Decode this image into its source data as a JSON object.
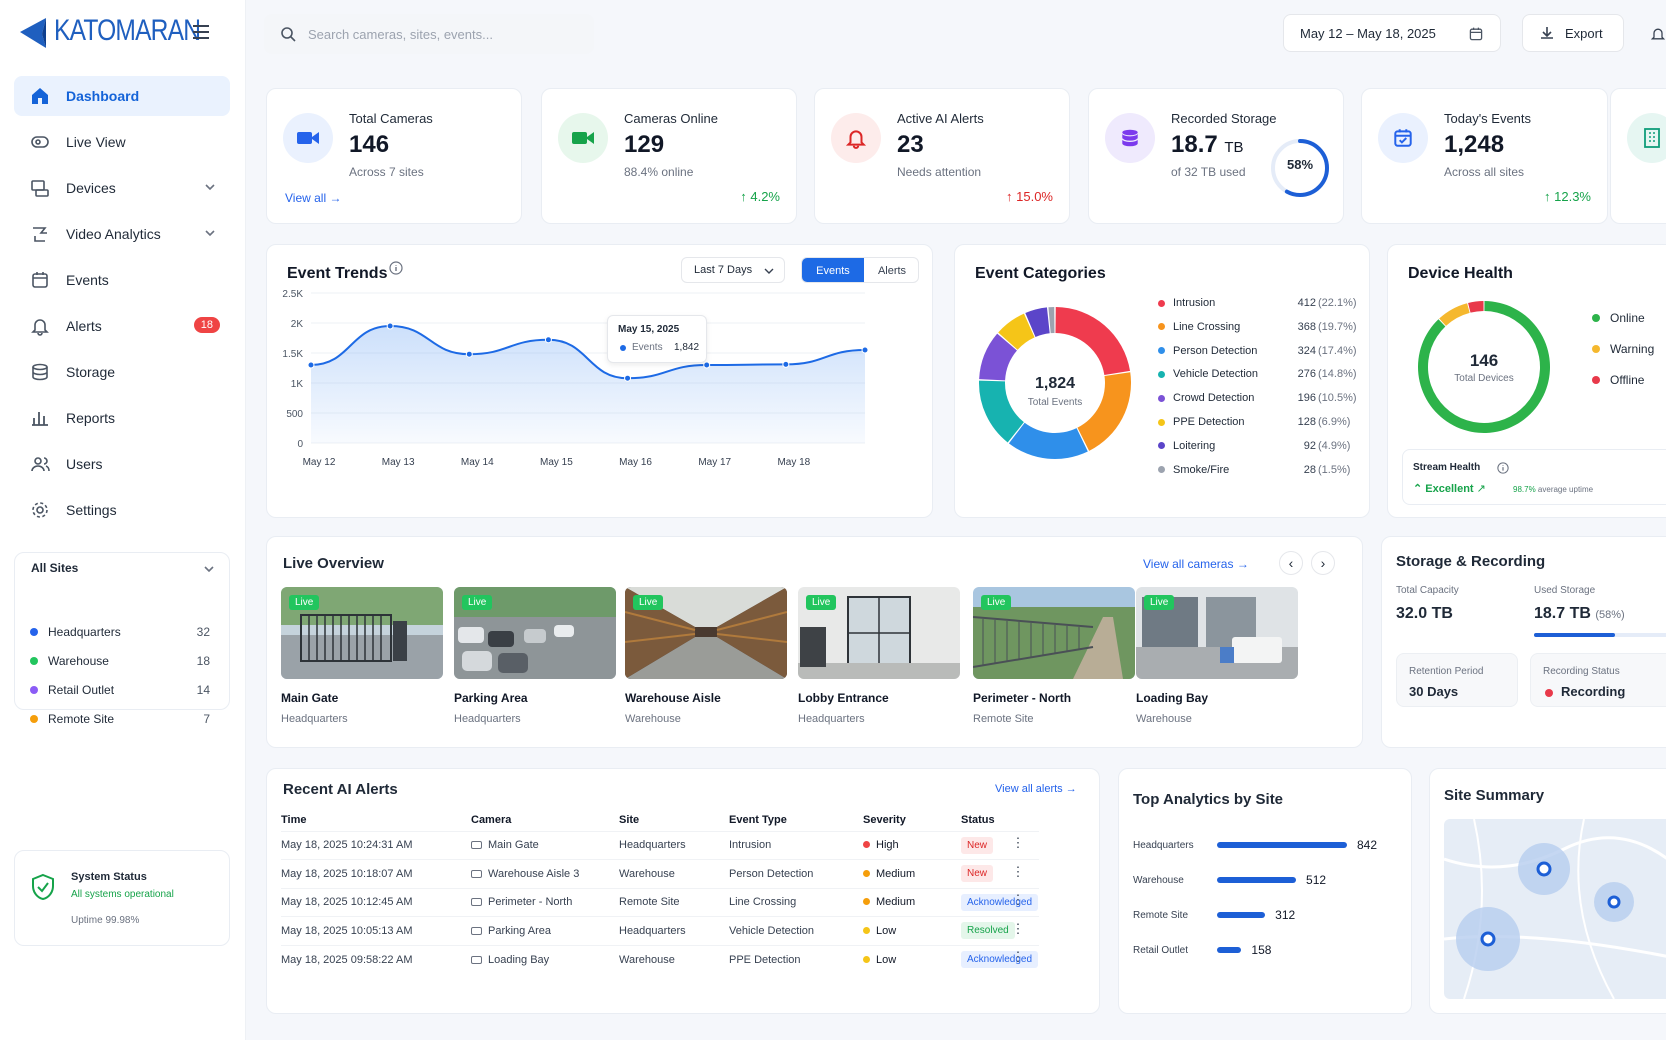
{
  "brand": {
    "name": "KATOMARAN"
  },
  "search": {
    "placeholder": "Search cameras, sites, events..."
  },
  "topbar": {
    "date_range": "May 12 – May 18, 2025",
    "export_label": "Export"
  },
  "nav": {
    "items": [
      {
        "label": "Dashboard",
        "icon": "home-icon",
        "active": true
      },
      {
        "label": "Live View",
        "icon": "camera-icon"
      },
      {
        "label": "Devices",
        "icon": "devices-icon",
        "expandable": true
      },
      {
        "label": "Video Analytics",
        "icon": "analytics-icon",
        "expandable": true
      },
      {
        "label": "Events",
        "icon": "calendar-icon"
      },
      {
        "label": "Alerts",
        "icon": "bell-icon",
        "badge": "18"
      },
      {
        "label": "Storage",
        "icon": "database-icon"
      },
      {
        "label": "Reports",
        "icon": "bar-chart-icon"
      },
      {
        "label": "Users",
        "icon": "users-icon"
      },
      {
        "label": "Settings",
        "icon": "gear-icon"
      }
    ]
  },
  "sites_panel": {
    "title": "All Sites",
    "sites": [
      {
        "name": "Headquarters",
        "count": "32",
        "color": "#2563eb"
      },
      {
        "name": "Warehouse",
        "count": "18",
        "color": "#22c55e"
      },
      {
        "name": "Retail Outlet",
        "count": "14",
        "color": "#8b5cf6"
      },
      {
        "name": "Remote Site",
        "count": "7",
        "color": "#f59e0b"
      }
    ]
  },
  "system_status": {
    "title": "System Status",
    "status": "All systems operational",
    "uptime": "Uptime 99.98%"
  },
  "kpis": [
    {
      "label": "Total Cameras",
      "value": "146",
      "sub": "Across 7 sites",
      "link": "View all",
      "icon": "video-camera-icon",
      "color": "#2563eb",
      "bg": "#eaf1fe"
    },
    {
      "label": "Cameras Online",
      "value": "129",
      "sub": "88.4% online",
      "change": "4.2%",
      "icon": "video-camera-icon",
      "color": "#16a34a",
      "bg": "#e7f7ec"
    },
    {
      "label": "Active AI Alerts",
      "value": "23",
      "sub": "Needs attention",
      "change": "15.0%",
      "icon": "bell-icon",
      "color": "#dc2626",
      "bg": "#fdeceb"
    },
    {
      "label": "Recorded Storage",
      "value": "18.7",
      "unit": "TB",
      "sub": "of 32 TB used",
      "ring": "58%",
      "ring_fraction": 0.58,
      "icon": "database-icon",
      "color": "#7c3aed",
      "bg": "#efeafd"
    },
    {
      "label": "Today's Events",
      "value": "1,248",
      "sub": "Across all sites",
      "change": "12.3%",
      "icon": "calendar-icon",
      "color": "#2563eb",
      "bg": "#eaf1fe"
    }
  ],
  "event_trends": {
    "title": "Event Trends",
    "range_select": "Last 7 Days",
    "toggle": [
      "Events",
      "Alerts"
    ],
    "tooltip": {
      "date": "May 15, 2025",
      "series": "Events",
      "value": "1,842"
    }
  },
  "chart_data": {
    "type": "area",
    "x": [
      "May 12",
      "May 13",
      "May 14",
      "May 15",
      "May 16",
      "May 17",
      "May 18"
    ],
    "yticks": [
      "0",
      "500",
      "1K",
      "1.5K",
      "2K",
      "2.5K"
    ],
    "ylim": [
      0,
      2500
    ],
    "grid": true,
    "series": [
      {
        "name": "Events",
        "x": [
          0,
          1,
          2,
          3,
          4,
          5,
          6,
          7
        ],
        "values": [
          1300,
          1950,
          1480,
          1720,
          1080,
          1300,
          1310,
          1550
        ]
      }
    ]
  },
  "event_categories": {
    "title": "Event Categories",
    "total": "1,824",
    "total_label": "Total Events",
    "items": [
      {
        "name": "Intrusion",
        "count": "412",
        "pct": "(22.1%)",
        "color": "#ef3b4e",
        "value": 22.1
      },
      {
        "name": "Line Crossing",
        "count": "368",
        "pct": "(19.7%)",
        "color": "#f7941d",
        "value": 19.7
      },
      {
        "name": "Person Detection",
        "count": "324",
        "pct": "(17.4%)",
        "color": "#2f8fea",
        "value": 17.4
      },
      {
        "name": "Vehicle Detection",
        "count": "276",
        "pct": "(14.8%)",
        "color": "#17b3b0",
        "value": 14.8
      },
      {
        "name": "Crowd Detection",
        "count": "196",
        "pct": "(10.5%)",
        "color": "#7b52d6",
        "value": 10.5
      },
      {
        "name": "PPE Detection",
        "count": "128",
        "pct": "(6.9%)",
        "color": "#f5c518",
        "value": 6.9
      },
      {
        "name": "Loitering",
        "count": "92",
        "pct": "(4.9%)",
        "color": "#5b45c9",
        "value": 4.9
      },
      {
        "name": "Smoke/Fire",
        "count": "28",
        "pct": "(1.5%)",
        "color": "#9ca3af",
        "value": 1.5
      }
    ]
  },
  "device_health": {
    "title": "Device Health",
    "total": "146",
    "total_label": "Total Devices",
    "segments": [
      {
        "name": "Online",
        "color": "#2db34a",
        "value": 0.88
      },
      {
        "name": "Warning",
        "color": "#f5b82e",
        "value": 0.08
      },
      {
        "name": "Offline",
        "color": "#e8394a",
        "value": 0.04
      }
    ],
    "stream_health_label": "Stream Health",
    "stream_health_value": "Excellent",
    "uptime_pct": "98.7%",
    "uptime_label": "average uptime"
  },
  "live_overview": {
    "title": "Live Overview",
    "view_all": "View all cameras",
    "live_badge": "Live",
    "cameras": [
      {
        "name": "Main Gate",
        "site": "Headquarters"
      },
      {
        "name": "Parking Area",
        "site": "Headquarters"
      },
      {
        "name": "Warehouse Aisle",
        "site": "Warehouse"
      },
      {
        "name": "Lobby Entrance",
        "site": "Headquarters"
      },
      {
        "name": "Perimeter - North",
        "site": "Remote Site"
      },
      {
        "name": "Loading Bay",
        "site": "Warehouse"
      }
    ]
  },
  "storage_recording": {
    "title": "Storage & Recording",
    "total_capacity_label": "Total Capacity",
    "total_capacity": "32.0 TB",
    "used_label": "Used Storage",
    "used": "18.7 TB",
    "used_pct": "(58%)",
    "used_fraction": 0.58,
    "retention_label": "Retention Period",
    "retention": "30 Days",
    "recording_status_label": "Recording Status",
    "recording_status": "Recording"
  },
  "recent_alerts": {
    "title": "Recent AI Alerts",
    "view_all": "View all alerts",
    "columns": [
      "Time",
      "Camera",
      "Site",
      "Event Type",
      "Severity",
      "Status"
    ],
    "rows": [
      {
        "time": "May 18, 2025 10:24:31 AM",
        "camera": "Main Gate",
        "site": "Headquarters",
        "event": "Intrusion",
        "severity": "High",
        "sev_color": "#ef4444",
        "status": "New",
        "status_color": "#dc2626",
        "status_bg": "#fde8e8"
      },
      {
        "time": "May 18, 2025 10:18:07 AM",
        "camera": "Warehouse Aisle 3",
        "site": "Warehouse",
        "event": "Person Detection",
        "severity": "Medium",
        "sev_color": "#f59e0b",
        "status": "New",
        "status_color": "#dc2626",
        "status_bg": "#fde8e8"
      },
      {
        "time": "May 18, 2025 10:12:45 AM",
        "camera": "Perimeter - North",
        "site": "Remote Site",
        "event": "Line Crossing",
        "severity": "Medium",
        "sev_color": "#f59e0b",
        "status": "Acknowledged",
        "status_color": "#2563eb",
        "status_bg": "#e7efff"
      },
      {
        "time": "May 18, 2025 10:05:13 AM",
        "camera": "Parking Area",
        "site": "Headquarters",
        "event": "Vehicle Detection",
        "severity": "Low",
        "sev_color": "#f5c518",
        "status": "Resolved",
        "status_color": "#16a34a",
        "status_bg": "#e4f6ea"
      },
      {
        "time": "May 18, 2025 09:58:22 AM",
        "camera": "Loading Bay",
        "site": "Warehouse",
        "event": "PPE Detection",
        "severity": "Low",
        "sev_color": "#f5c518",
        "status": "Acknowledged",
        "status_color": "#2563eb",
        "status_bg": "#e7efff"
      }
    ]
  },
  "top_analytics": {
    "title": "Top Analytics by Site",
    "sites": [
      {
        "name": "Headquarters",
        "value": 842
      },
      {
        "name": "Warehouse",
        "value": 512
      },
      {
        "name": "Remote Site",
        "value": 312
      },
      {
        "name": "Retail Outlet",
        "value": 158
      }
    ]
  },
  "site_summary": {
    "title": "Site Summary"
  }
}
